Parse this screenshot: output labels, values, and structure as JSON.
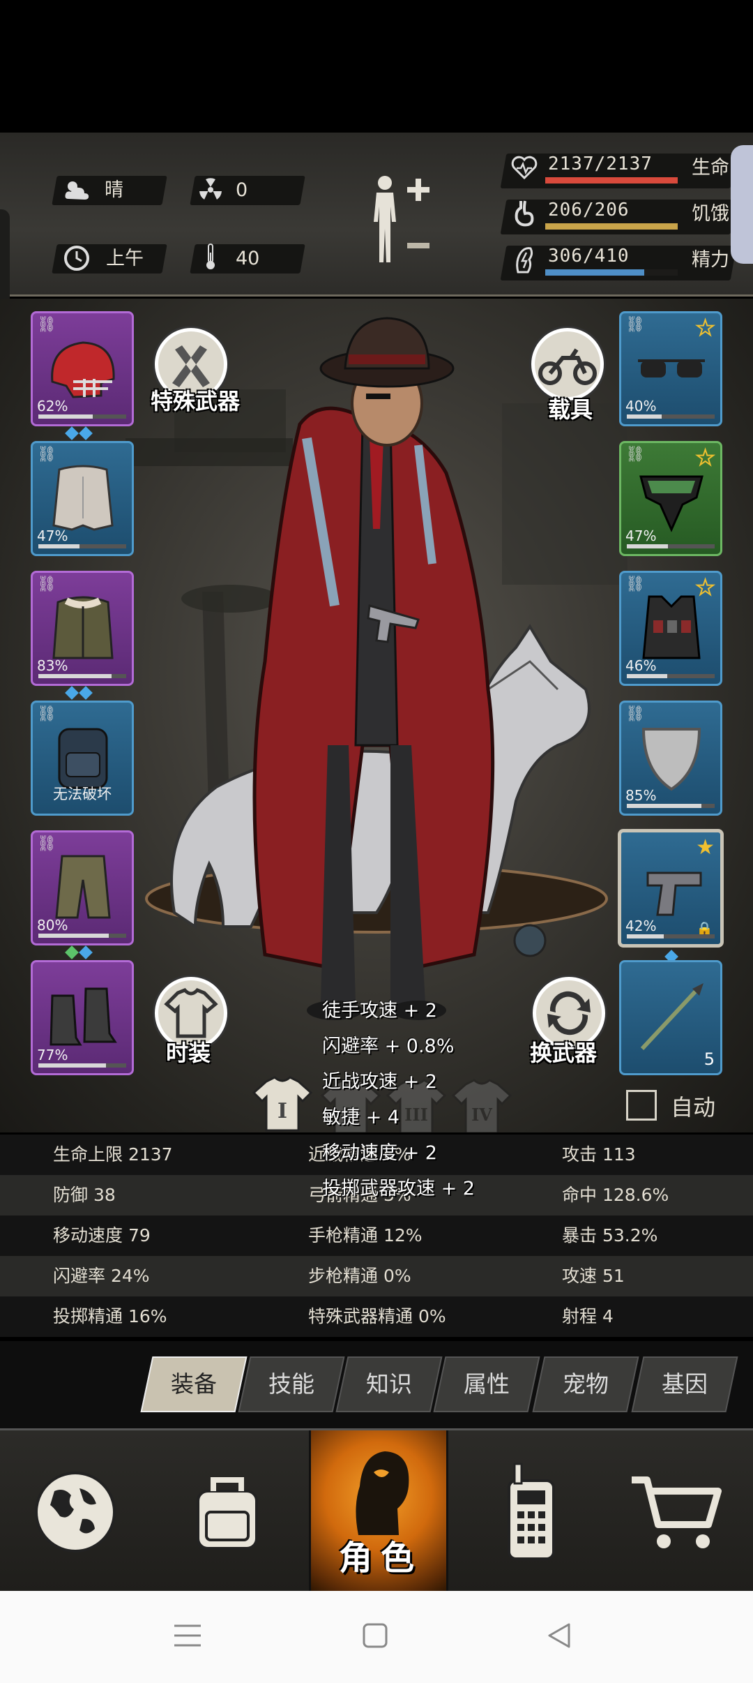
{
  "status": {
    "weather": "晴",
    "radiation": "0",
    "time_of_day": "上午",
    "temperature": "40",
    "health": {
      "value": "2137/2137",
      "label": "生命",
      "fraction": 1.0,
      "color": "#d94a3c"
    },
    "hunger": {
      "value": "206/206",
      "label": "饥饿",
      "fraction": 1.0,
      "color": "#c9a44a"
    },
    "energy": {
      "value": "306/410",
      "label": "精力",
      "fraction": 0.746,
      "color": "#4f8fc7"
    },
    "icons": [
      "cloud-sun-icon",
      "radiation-icon",
      "clock-icon",
      "thermometer-icon",
      "heart-icon",
      "stomach-icon",
      "energy-icon",
      "body-figure-icon"
    ]
  },
  "left_slots": [
    {
      "name": "helmet",
      "rarity": "purple",
      "durability": "62%",
      "fill": 0.62,
      "gems": 2
    },
    {
      "name": "shirt",
      "rarity": "blue",
      "durability": "47%",
      "fill": 0.47,
      "gems": 0
    },
    {
      "name": "jacket",
      "rarity": "purple",
      "durability": "83%",
      "fill": 0.83,
      "gems": 2
    },
    {
      "name": "backpack",
      "rarity": "blue",
      "durability": "无法破坏",
      "fill": 0,
      "gems": 0
    },
    {
      "name": "pants",
      "rarity": "purple",
      "durability": "80%",
      "fill": 0.8,
      "gems": 2
    },
    {
      "name": "boots",
      "rarity": "purple",
      "durability": "77%",
      "fill": 0.77,
      "gems": 0
    }
  ],
  "right_slots": [
    {
      "name": "sunglasses",
      "rarity": "blue",
      "durability": "40%",
      "fill": 0.4,
      "star": "hollow"
    },
    {
      "name": "gas-mask",
      "rarity": "green",
      "durability": "47%",
      "fill": 0.47,
      "star": "hollow"
    },
    {
      "name": "vest",
      "rarity": "blue",
      "durability": "46%",
      "fill": 0.46,
      "star": "hollow"
    },
    {
      "name": "shield",
      "rarity": "blue",
      "durability": "85%",
      "fill": 0.85,
      "star": "none"
    },
    {
      "name": "pistol",
      "rarity": "grey",
      "durability": "42%",
      "fill": 0.42,
      "star": "filled",
      "locked": true,
      "gems": 1
    },
    {
      "name": "spear",
      "rarity": "blue",
      "quantity": "5"
    }
  ],
  "buttons": {
    "special_weapon": "特殊武器",
    "vehicle": "载具",
    "fashion": "时装",
    "switch_weapon": "换武器",
    "auto": "自动"
  },
  "tiers": [
    "I",
    "II",
    "III",
    "IV"
  ],
  "tooltip": [
    "徒手攻速 + 2",
    "闪避率 + 0.8%",
    "近战攻速 + 2",
    "敏捷 + 4",
    "移动速度 + 2",
    "投掷武器攻速 + 2"
  ],
  "stats": [
    [
      "生命上限 2137",
      "近战精通 6%",
      "攻击 113"
    ],
    [
      "防御 38",
      "弓箭精通 3%",
      "命中 128.6%"
    ],
    [
      "移动速度 79",
      "手枪精通 12%",
      "暴击 53.2%"
    ],
    [
      "闪避率 24%",
      "步枪精通 0%",
      "攻速 51"
    ],
    [
      "投掷精通 16%",
      "特殊武器精通 0%",
      "射程 4"
    ]
  ],
  "tabs": [
    "装备",
    "技能",
    "知识",
    "属性",
    "宠物",
    "基因"
  ],
  "active_tab": 0,
  "nav": {
    "items": [
      "globe-icon",
      "backpack-icon",
      "character-icon",
      "radio-icon",
      "cart-icon"
    ],
    "role_label": "角色"
  },
  "colors": {
    "rarity_purple": "#7d3d99",
    "rarity_blue": "#2f6b92",
    "rarity_green": "#3d7a36",
    "accent_orange": "#e0851a",
    "gem_blue": "#4aa8e8",
    "gem_green": "#5cc46a"
  }
}
